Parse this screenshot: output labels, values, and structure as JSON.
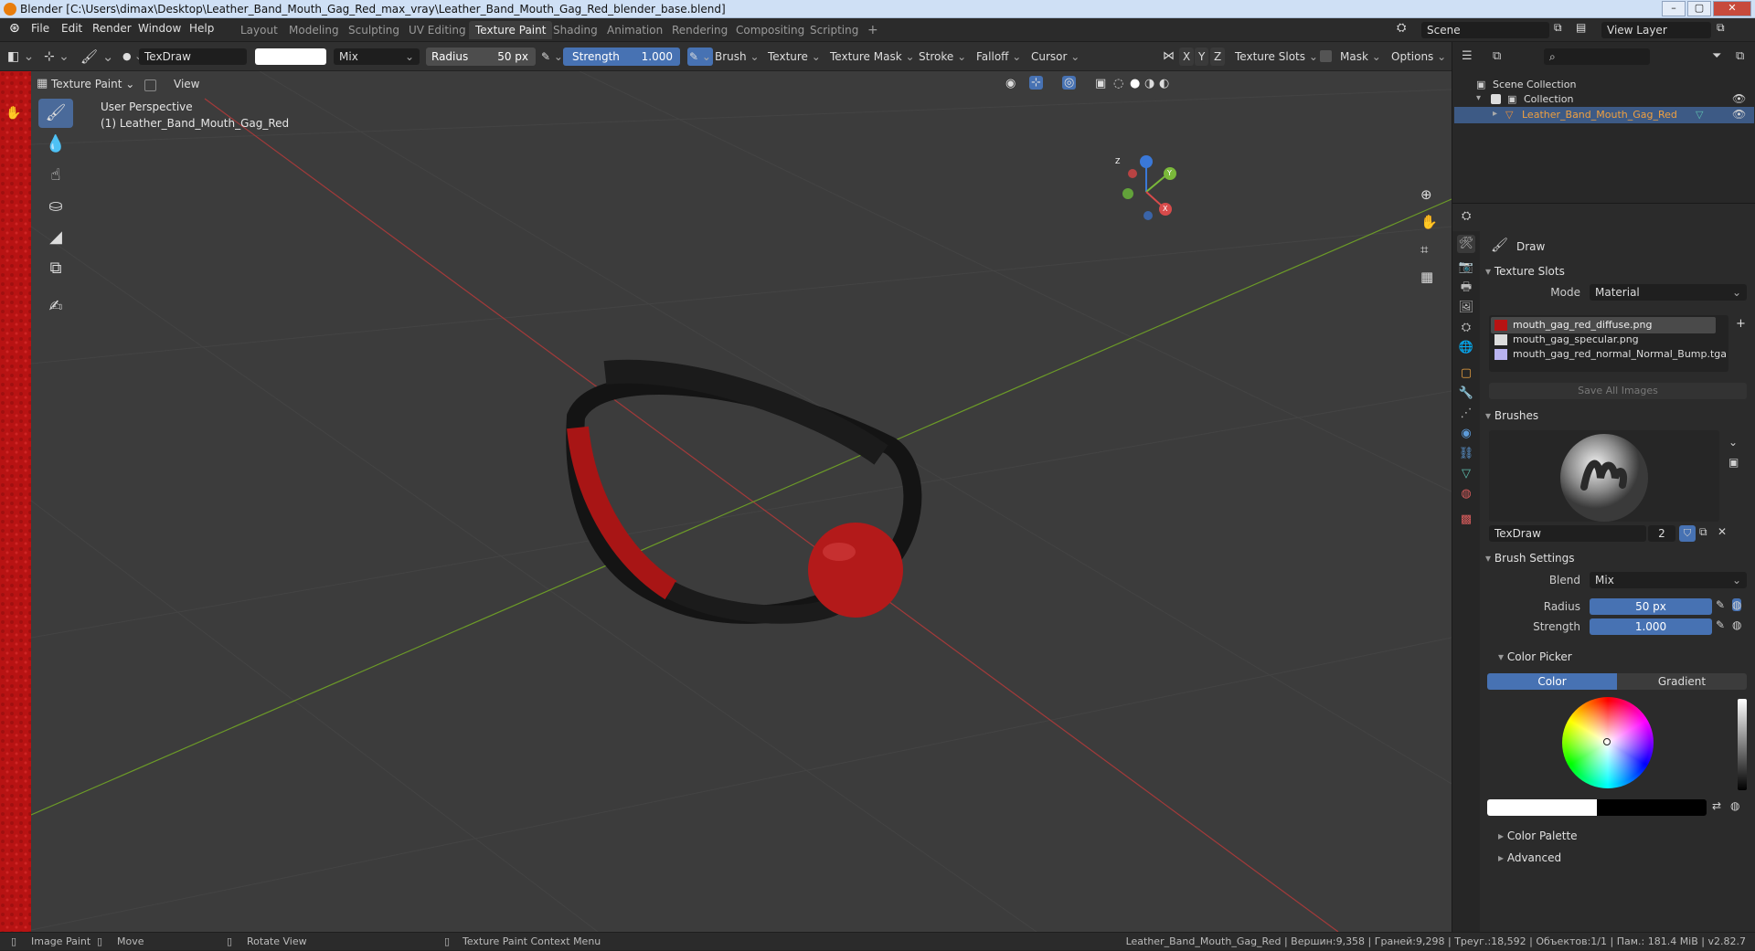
{
  "window": {
    "title": "Blender [C:\\Users\\dimax\\Desktop\\Leather_Band_Mouth_Gag_Red_max_vray\\Leather_Band_Mouth_Gag_Red_blender_base.blend]",
    "minimize": "–",
    "maximize": "▢",
    "close": "✕"
  },
  "menu": [
    "File",
    "Edit",
    "Render",
    "Window",
    "Help"
  ],
  "workspaces": [
    "Layout",
    "Modeling",
    "Sculpting",
    "UV Editing",
    "Texture Paint",
    "Shading",
    "Animation",
    "Rendering",
    "Compositing",
    "Scripting"
  ],
  "active_workspace": "Texture Paint",
  "scene": {
    "name": "Scene",
    "view_layer": "View Layer"
  },
  "toolheader": {
    "brush_name": "TexDraw",
    "blend": "Mix",
    "radius_label": "Radius",
    "radius_value": "50 px",
    "strength_label": "Strength",
    "strength_value": "1.000",
    "menus": [
      "Brush",
      "Texture",
      "Texture Mask",
      "Stroke",
      "Falloff",
      "Cursor"
    ],
    "axes": [
      "X",
      "Y",
      "Z"
    ],
    "texture_slots": "Texture Slots",
    "mask": "Mask",
    "options": "Options"
  },
  "subheader": {
    "mode": "Texture Paint",
    "view": "View"
  },
  "viewport": {
    "perspective": "User Perspective",
    "object": "(1) Leather_Band_Mouth_Gag_Red",
    "gizmo_axes": [
      "X",
      "Y",
      "Z"
    ]
  },
  "outliner": {
    "root": "Scene Collection",
    "collection": "Collection",
    "object": "Leather_Band_Mouth_Gag_Red"
  },
  "properties": {
    "tool_name": "Draw",
    "texture_slots_title": "Texture Slots",
    "mode_label": "Mode",
    "mode_value": "Material",
    "slots": [
      {
        "name": "mouth_gag_red_diffuse.png",
        "color": "#b81313",
        "active": true
      },
      {
        "name": "mouth_gag_specular.png",
        "color": "#dddddd",
        "active": false
      },
      {
        "name": "mouth_gag_red_normal_Normal_Bump.tga",
        "color": "#b9b3f0",
        "active": false
      }
    ],
    "save_all": "Save All Images",
    "brushes_title": "Brushes",
    "brush_name": "TexDraw",
    "brush_users": "2",
    "brush_settings_title": "Brush Settings",
    "blend_label": "Blend",
    "blend_value": "Mix",
    "radius_label": "Radius",
    "radius_value": "50 px",
    "strength_label": "Strength",
    "strength_value": "1.000",
    "color_picker_title": "Color Picker",
    "color_tab": "Color",
    "gradient_tab": "Gradient",
    "color_palette": "Color Palette",
    "advanced": "Advanced"
  },
  "statusbar": {
    "image_paint": "Image Paint",
    "move": "Move",
    "rotate_view": "Rotate View",
    "context_menu": "Texture Paint Context Menu",
    "stats": "Leather_Band_Mouth_Gag_Red | Вершин:9,358 | Граней:9,298 | Треуг.:18,592 | Объектов:1/1 | Пам.: 181.4 MiB | v2.82.7"
  },
  "colors": {
    "accent": "#4772b3",
    "paint": "#b81313",
    "background": "#3c3c3c"
  }
}
